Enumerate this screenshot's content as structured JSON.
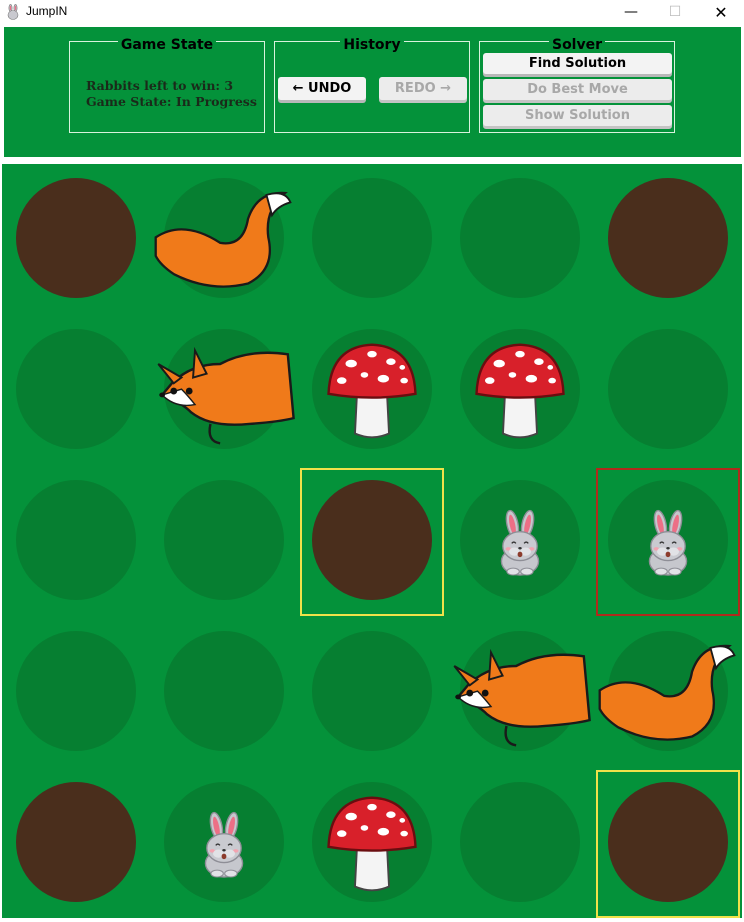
{
  "window": {
    "title": "JumpIN",
    "icon": "rabbit-icon",
    "controls": {
      "minimize": "—",
      "maximize": "☐",
      "close": "✕"
    }
  },
  "panel": {
    "game_state": {
      "title": "Game State",
      "rabbits_left": "Rabbits left to win: 3",
      "status": "Game State: In Progress"
    },
    "history": {
      "title": "History",
      "undo_label": "← UNDO",
      "redo_label": "REDO →",
      "redo_enabled": false
    },
    "solver": {
      "title": "Solver",
      "find_solution_label": "Find Solution",
      "best_move_label": "Do Best Move",
      "show_solution_label": "Show Solution",
      "best_move_enabled": false,
      "show_solution_enabled": false
    }
  },
  "board": {
    "rows": 5,
    "cols": 5,
    "colors": {
      "grass": "#04923a",
      "hole": "#067f31",
      "dirt_hole": "#4a2e1c",
      "highlight_yellow": "#f0e24a",
      "highlight_red": "#b02a1c"
    },
    "cells": [
      [
        "dirt-hole",
        "fox-tail",
        "hole",
        "hole",
        "dirt-hole"
      ],
      [
        "hole",
        "fox-head",
        "mushroom",
        "mushroom",
        "hole"
      ],
      [
        "hole",
        "hole",
        "dirt-hole",
        "rabbit",
        "rabbit"
      ],
      [
        "hole",
        "hole",
        "hole",
        "fox-head",
        "fox-tail"
      ],
      [
        "dirt-hole",
        "rabbit",
        "mushroom",
        "hole",
        "dirt-hole"
      ]
    ],
    "highlights": [
      {
        "row": 2,
        "col": 2,
        "color": "yellow"
      },
      {
        "row": 2,
        "col": 4,
        "color": "red"
      },
      {
        "row": 4,
        "col": 4,
        "color": "yellow"
      }
    ]
  }
}
